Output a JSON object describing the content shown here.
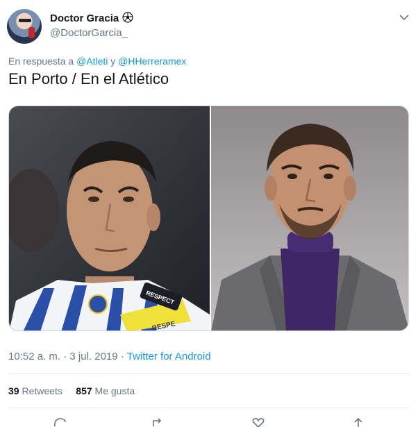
{
  "author": {
    "display_name": "Doctor Gracia",
    "handle": "@DoctorGarcia_"
  },
  "reply": {
    "prefix": "En respuesta a",
    "mention1": "@Atleti",
    "conjunction": "y",
    "mention2": "@HHerreramex"
  },
  "tweet": {
    "text": "En Porto / En el Atlético"
  },
  "media": {
    "left_badge_text": "RESPECT",
    "left_armband_text": "RESPE"
  },
  "meta": {
    "time": "10:52 a. m.",
    "sep": "·",
    "date": "3 jul. 2019",
    "source": "Twitter for Android"
  },
  "stats": {
    "retweets_count": "39",
    "retweets_label": "Retweets",
    "likes_count": "857",
    "likes_label": "Me gusta"
  },
  "icons": {
    "author_emoji": "soccer-ball-icon",
    "menu": "chevron-down-icon",
    "actions": [
      "reply-icon",
      "retweet-icon",
      "like-icon",
      "share-icon"
    ]
  },
  "colors": {
    "link": "#1b95e0",
    "muted": "#657786",
    "text": "#14171a",
    "border": "#e6ecf0"
  }
}
